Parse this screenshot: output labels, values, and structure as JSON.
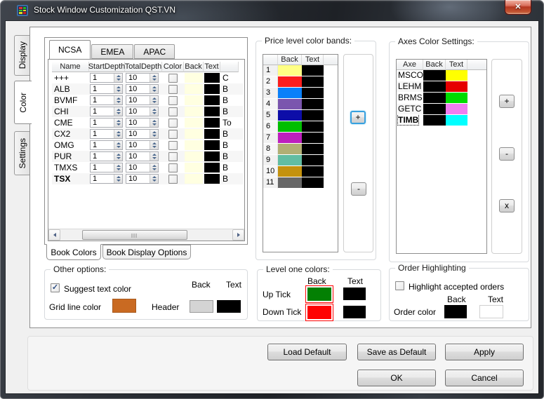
{
  "window": {
    "title": "Stock Window Customization QST.VN",
    "close_glyph": "✕"
  },
  "side_tabs": {
    "items": [
      {
        "label": "Display",
        "active": false
      },
      {
        "label": "Color",
        "active": true
      },
      {
        "label": "Settings",
        "active": false
      }
    ]
  },
  "book": {
    "region_tabs": [
      {
        "label": "NCSA",
        "active": true
      },
      {
        "label": "EMEA",
        "active": false
      },
      {
        "label": "APAC",
        "active": false
      }
    ],
    "columns": {
      "name": "Name",
      "start_depth": "StartDepth",
      "total_depth": "TotalDepth",
      "color": "Color",
      "back": "Back",
      "text": "Text"
    },
    "rows": [
      {
        "name": "+++",
        "start_depth": "1",
        "total_depth": "10",
        "color_checked": false,
        "back_color": "#FFFFE1",
        "text_color": "#000000",
        "extra": "C",
        "bold": false
      },
      {
        "name": "ALB",
        "start_depth": "1",
        "total_depth": "10",
        "color_checked": false,
        "back_color": "#FFFFE1",
        "text_color": "#000000",
        "extra": "B",
        "bold": false
      },
      {
        "name": "BVMF",
        "start_depth": "1",
        "total_depth": "10",
        "color_checked": false,
        "back_color": "#FFFFE1",
        "text_color": "#000000",
        "extra": "B",
        "bold": false
      },
      {
        "name": "CHI",
        "start_depth": "1",
        "total_depth": "10",
        "color_checked": false,
        "back_color": "#FFFFE1",
        "text_color": "#000000",
        "extra": "B",
        "bold": false
      },
      {
        "name": "CME",
        "start_depth": "1",
        "total_depth": "10",
        "color_checked": false,
        "back_color": "#FFFFE1",
        "text_color": "#000000",
        "extra": "To",
        "bold": false
      },
      {
        "name": "CX2",
        "start_depth": "1",
        "total_depth": "10",
        "color_checked": false,
        "back_color": "#FFFFE1",
        "text_color": "#000000",
        "extra": "B",
        "bold": false
      },
      {
        "name": "OMG",
        "start_depth": "1",
        "total_depth": "10",
        "color_checked": false,
        "back_color": "#FFFFE1",
        "text_color": "#000000",
        "extra": "B",
        "bold": false
      },
      {
        "name": "PUR",
        "start_depth": "1",
        "total_depth": "10",
        "color_checked": false,
        "back_color": "#FFFFE1",
        "text_color": "#000000",
        "extra": "B",
        "bold": false
      },
      {
        "name": "TMXS",
        "start_depth": "1",
        "total_depth": "10",
        "color_checked": false,
        "back_color": "#FFFFE1",
        "text_color": "#000000",
        "extra": "B",
        "bold": false
      },
      {
        "name": "TSX",
        "start_depth": "1",
        "total_depth": "10",
        "color_checked": false,
        "back_color": "#FFFFE1",
        "text_color": "#000000",
        "extra": "B",
        "bold": true
      }
    ],
    "bottom_tabs": [
      {
        "label": "Book Colors",
        "active": true
      },
      {
        "label": "Book Display Options",
        "active": false
      }
    ]
  },
  "price_bands": {
    "title": "Price level color bands:",
    "columns": {
      "back": "Back",
      "text": "Text"
    },
    "rows": [
      {
        "num": "1",
        "back_color": "#FFFF84",
        "text_color": "#000000"
      },
      {
        "num": "2",
        "back_color": "#FB1D1D",
        "text_color": "#000000"
      },
      {
        "num": "3",
        "back_color": "#0980FA",
        "text_color": "#000000"
      },
      {
        "num": "4",
        "back_color": "#7A55AE",
        "text_color": "#000000"
      },
      {
        "num": "5",
        "back_color": "#0D0DA8",
        "text_color": "#000000"
      },
      {
        "num": "6",
        "back_color": "#00BE00",
        "text_color": "#000000"
      },
      {
        "num": "7",
        "back_color": "#BE1FBE",
        "text_color": "#000000"
      },
      {
        "num": "8",
        "back_color": "#B1AF74",
        "text_color": "#000000"
      },
      {
        "num": "9",
        "back_color": "#62BDA2",
        "text_color": "#000000"
      },
      {
        "num": "10",
        "back_color": "#C4920E",
        "text_color": "#000000"
      },
      {
        "num": "11",
        "back_color": "#676767",
        "text_color": "#000000"
      }
    ],
    "add_label": "+",
    "remove_label": "-"
  },
  "axes": {
    "title": "Axes Color Settings:",
    "columns": {
      "axe": "Axe",
      "back": "Back",
      "text": "Text"
    },
    "rows": [
      {
        "axe": "MSCO",
        "back_color": "#000000",
        "text_color": "#FFFF00",
        "bold": false,
        "focused": false
      },
      {
        "axe": "LEHM",
        "back_color": "#000000",
        "text_color": "#E60000",
        "bold": false,
        "focused": false
      },
      {
        "axe": "BRMS",
        "back_color": "#000000",
        "text_color": "#00DC00",
        "bold": false,
        "focused": false
      },
      {
        "axe": "GETC",
        "back_color": "#000000",
        "text_color": "#F07DF0",
        "bold": false,
        "focused": false
      },
      {
        "axe": "TIMB",
        "back_color": "#000000",
        "text_color": "#00FFFF",
        "bold": true,
        "focused": true
      }
    ],
    "add_label": "+",
    "remove_label": "-",
    "delete_label": "x"
  },
  "other_options": {
    "title": "Other options:",
    "suggest_checkbox_label": "Suggest  text color",
    "suggest_checked": true,
    "back_header": "Back",
    "text_header": "Text",
    "grid_line_label": "Grid line color",
    "grid_line_color": "#C96A22",
    "header_label": "Header",
    "header_back_color": "#D4D4D4",
    "header_text_color": "#000000"
  },
  "level_one": {
    "title": "Level one colors:",
    "back_header": "Back",
    "text_header": "Text",
    "up_label": "Up Tick",
    "up_back_color": "#038003",
    "up_text_color": "#000000",
    "down_label": "Down Tick",
    "down_back_color": "#FE0202",
    "down_text_color": "#000000",
    "swatch_ring_color": "#FF0000"
  },
  "order_highlighting": {
    "title": "Order Highlighting",
    "highlight_checkbox_label": "Highlight accepted orders",
    "highlight_checked": false,
    "back_header": "Back",
    "text_header": "Text",
    "order_color_label": "Order color",
    "order_back_color": "#000000",
    "order_text_color": "#FFFFFF"
  },
  "footer": {
    "load_default": "Load Default",
    "save_as_default": "Save as Default",
    "apply": "Apply",
    "ok": "OK",
    "cancel": "Cancel"
  }
}
